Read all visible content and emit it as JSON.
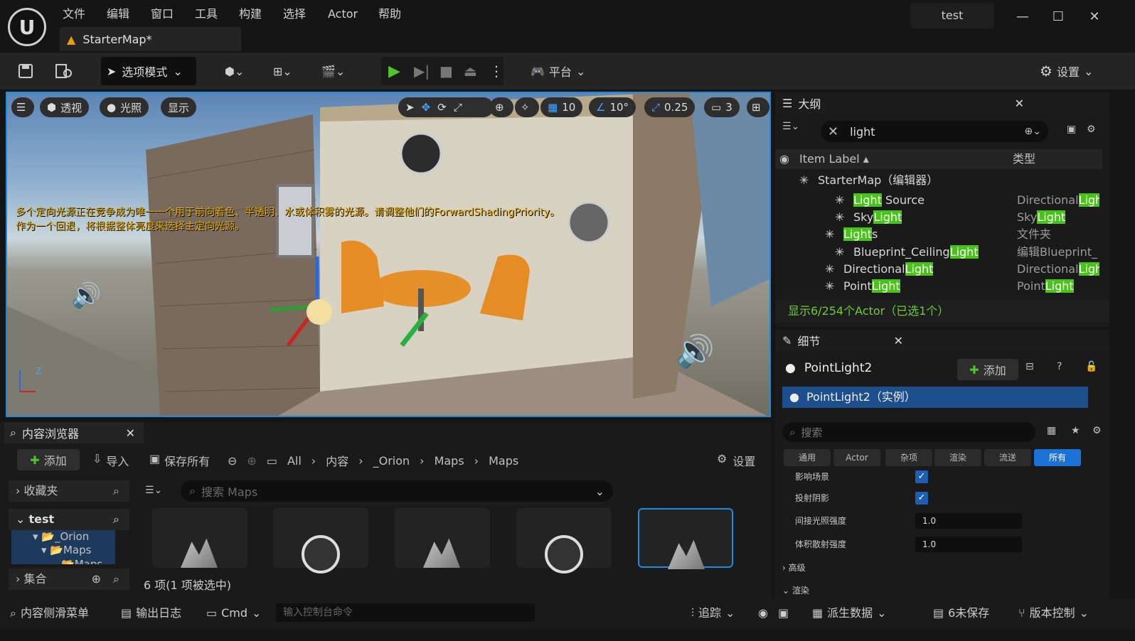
{
  "app": {
    "logo": "U",
    "menu": [
      "文件",
      "编辑",
      "窗口",
      "工具",
      "构建",
      "选择",
      "Actor",
      "帮助"
    ],
    "doc_tab": "StarterMap*",
    "project": "test",
    "window_controls": {
      "min": "—",
      "max": "☐",
      "close": "✕"
    }
  },
  "toolbar": {
    "mode": "选项模式",
    "platform": "平台",
    "settings": "设置"
  },
  "viewport": {
    "perspective": "透视",
    "lighting": "光照",
    "show": "显示",
    "grid": "10",
    "angle": "10°",
    "scale": "0.25",
    "camera_speed": "3",
    "warning_line1": "多个定向光源正在竞争成为唯一一个用于前向着色、半透明、水或体积雾的光源。请调整他们的ForwardShadingPriority。",
    "warning_line2": "作为一个回退，将根据整体亮度来选择主定向光源。",
    "axis_z": "Z"
  },
  "outliner": {
    "title": "大纲",
    "search": "light",
    "col_label": "Item Label ▴",
    "col_type": "类型",
    "rows": [
      {
        "pre": "StarterMap（编辑器）",
        "hl": "",
        "post": "",
        "type": "",
        "indent": 60
      },
      {
        "pre": "",
        "hl": "Light",
        "post": " Source",
        "type_pre": "Directional",
        "type_hl": "Ligh",
        "indent": 110
      },
      {
        "pre": "Sky",
        "hl": "Light",
        "post": "",
        "type_pre": "Sky",
        "type_hl": "Light",
        "indent": 110
      },
      {
        "pre": "",
        "hl": "Light",
        "post": "s",
        "type_pre": "文件夹",
        "type_hl": "",
        "indent": 96
      },
      {
        "pre": "Blueprint_Ceiling",
        "hl": "Light",
        "post": "",
        "type_pre": "编辑Blueprint_",
        "type_hl": "",
        "indent": 110
      },
      {
        "pre": "Directional",
        "hl": "Light",
        "post": "",
        "type_pre": "Directional",
        "type_hl": "Ligh",
        "indent": 96
      },
      {
        "pre": "Point",
        "hl": "Light",
        "post": "",
        "type_pre": "Point",
        "type_hl": "Light",
        "indent": 96
      }
    ],
    "footer": "显示6/254个Actor（已选1个）"
  },
  "details": {
    "title": "细节",
    "actor": "PointLight2",
    "add": "添加",
    "instance": "PointLight2（实例）",
    "search_placeholder": "搜索",
    "filters": [
      "通用",
      "Actor",
      "杂项",
      "渲染",
      "流送",
      "所有"
    ],
    "props": [
      {
        "label": "影响场景",
        "kind": "check"
      },
      {
        "label": "投射阴影",
        "kind": "check"
      },
      {
        "label": "间接光照强度",
        "kind": "num",
        "value": "1.0"
      },
      {
        "label": "体积散射强度",
        "kind": "num",
        "value": "1.0"
      }
    ],
    "sections": [
      "高级",
      "渲染"
    ]
  },
  "content": {
    "title": "内容浏览器",
    "add": "添加",
    "import": "导入",
    "save_all": "保存所有",
    "settings": "设置",
    "breadcrumb": [
      "All",
      "内容",
      "_Orion",
      "Maps",
      "Maps"
    ],
    "favorites": "收藏夹",
    "project": "test",
    "tree": [
      "_Orion",
      "Maps",
      "Maps"
    ],
    "collections": "集合",
    "search_placeholder": "搜索 Maps",
    "count": "6 项(1 项被选中)"
  },
  "status": {
    "drawer": "内容侧滑菜单",
    "output_log": "输出日志",
    "cmd": "Cmd",
    "console_placeholder": "输入控制台命令",
    "trace": "追踪",
    "derived_data": "派生数据",
    "unsaved": "6未保存",
    "source_control": "版本控制"
  }
}
